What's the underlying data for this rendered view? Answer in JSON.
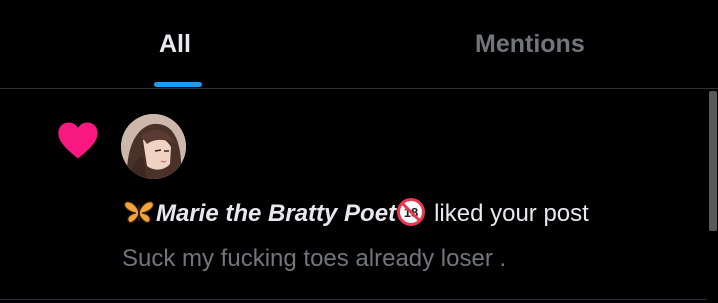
{
  "tabs": [
    {
      "label": "All",
      "active": true
    },
    {
      "label": "Mentions",
      "active": false
    }
  ],
  "colors": {
    "accent": "#1d9bf0",
    "like_heart": "#f91880",
    "primary_text": "#e7e9ea",
    "secondary_text": "#71767b",
    "divider": "#2f3336",
    "background": "#000000"
  },
  "notification": {
    "type_icon": "heart-icon",
    "avatar_icon": "user-avatar",
    "name_prefix_emoji": "butterfly-emoji",
    "user_name": "Marie the Bratty Poet",
    "name_suffix_emoji": "no-under-18-emoji",
    "action_text": "liked your post",
    "post_text": "Suck my fucking toes already loser ."
  }
}
